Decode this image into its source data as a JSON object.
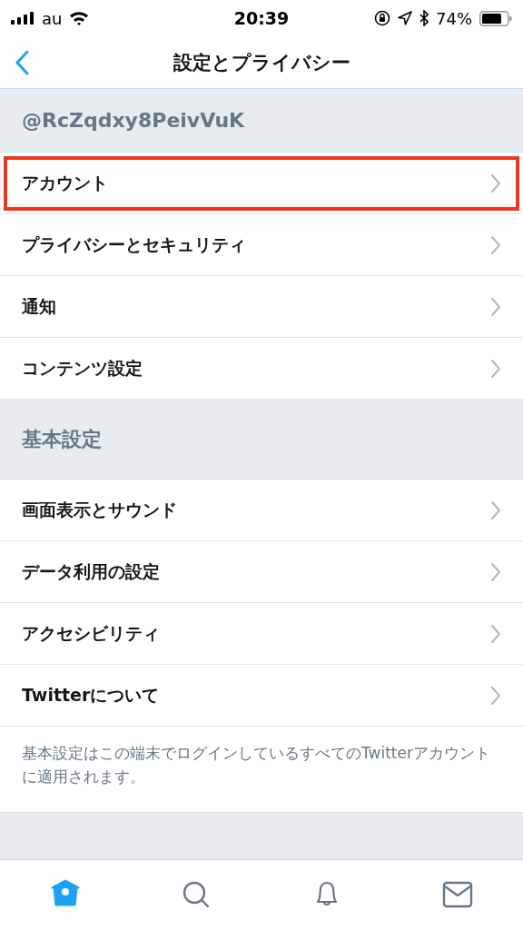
{
  "status_bar": {
    "carrier": "au",
    "time": "20:39",
    "battery": "74%"
  },
  "nav": {
    "title": "設定とプライバシー"
  },
  "sections": [
    {
      "header": "@RcZqdxy8PeivVuK",
      "kind": "handle",
      "items": [
        {
          "label": "アカウント",
          "highlighted": true
        },
        {
          "label": "プライバシーとセキュリティ",
          "highlighted": false
        },
        {
          "label": "通知",
          "highlighted": false
        },
        {
          "label": "コンテンツ設定",
          "highlighted": false
        }
      ]
    },
    {
      "header": "基本設定",
      "kind": "plain",
      "items": [
        {
          "label": "画面表示とサウンド",
          "highlighted": false
        },
        {
          "label": "データ利用の設定",
          "highlighted": false
        },
        {
          "label": "アクセシビリティ",
          "highlighted": false
        },
        {
          "label": "Twitterについて",
          "highlighted": false
        }
      ],
      "note": "基本設定はこの端末でログインしているすべてのTwitterアカウントに適用されます。"
    }
  ],
  "tabs": [
    {
      "kind": "home",
      "selected": true
    },
    {
      "kind": "search",
      "selected": false
    },
    {
      "kind": "notifications",
      "selected": false
    },
    {
      "kind": "messages",
      "selected": false
    }
  ]
}
